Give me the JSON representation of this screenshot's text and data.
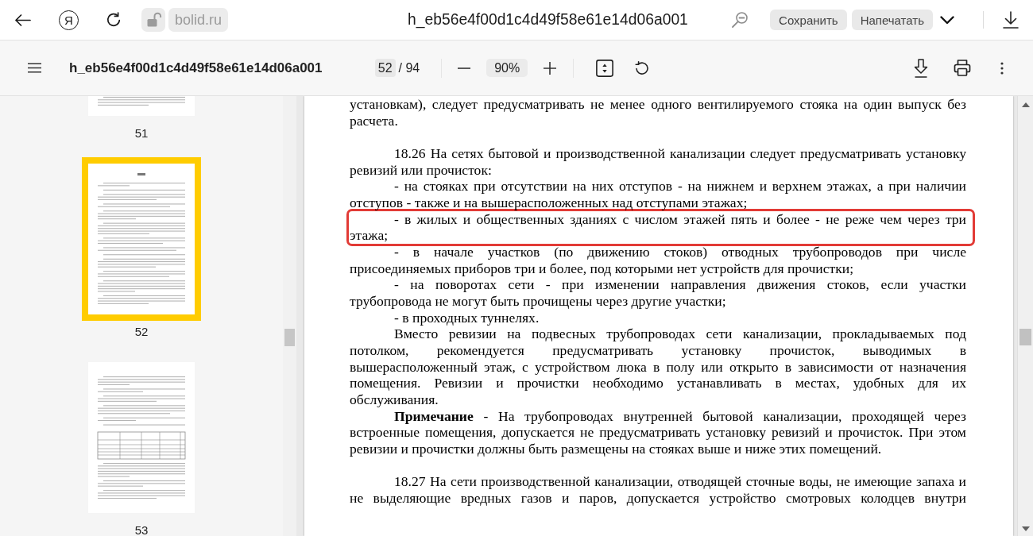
{
  "browser": {
    "logo_letter": "Я",
    "address": "bolid.ru",
    "title": "h_eb56e4f00d1c4d49f58e61e14d06a001",
    "buttons": [
      "Сохранить",
      "Напечатать"
    ]
  },
  "viewer": {
    "file_name": "h_eb56e4f00d1c4d49f58e61e14d06a001",
    "page_current": "52",
    "page_total": "/ 94",
    "zoom": "90%"
  },
  "thumbnails": [
    {
      "label": "51",
      "kind": "text",
      "selected": false
    },
    {
      "label": "52",
      "kind": "text",
      "selected": true
    },
    {
      "label": "53",
      "kind": "table",
      "selected": false
    }
  ],
  "document": {
    "sections": [
      {
        "continued_from_previous_page": true,
        "continues_on_next_page": false,
        "paragraphs": [
          {
            "text": "установкам), следует предусматривать не менее одного вентилируемого стояка на один выпуск без\nрасчета.",
            "highlighted": false
          }
        ]
      },
      {
        "continued_from_previous_page": false,
        "continues_on_next_page": false,
        "paragraphs": [
          {
            "text": "18.26 На сетях бытовой и производственной канализации следует предусматривать установку\nревизий или прочисток:",
            "highlighted": false
          },
          {
            "text": "- на стояках при отсутствии на них отступов - на нижнем и верхнем этажах, а при наличии\nотступов - также и на вышерасположенных над отступами этажах;",
            "highlighted": false
          },
          {
            "text": "- в жилых и общественных зданиях с числом этажей пять и более - не реже чем через три\nэтажа;",
            "highlighted": true
          },
          {
            "text": "- в начале участков (по движению стоков) отводных трубопроводов при числе\nприсоединяемых приборов три и более, под которыми нет устройств для прочистки;",
            "highlighted": false
          },
          {
            "text": "- на поворотах сети - при изменении направления движения стоков, если участки\nтрубопровода не могут быть прочищены через другие участки;",
            "highlighted": false
          },
          {
            "text": "- в проходных туннелях.",
            "highlighted": false
          },
          {
            "text": "Вместо ревизии на подвесных трубопроводах сети канализации, прокладываемых под\nпотолком, рекомендуется предусматривать установку прочисток, выводимых в\nвышерасположенный этаж, с устройством люка в полу или открыто в зависимости от назначения\nпомещения. Ревизии и прочистки необходимо устанавливать в местах, удобных для их\nобслуживания.",
            "highlighted": false
          },
          {
            "text": "**Примечание** - На трубопроводах внутренней бытовой канализации, проходящей через\nвстроенные помещения, допускается не предусматривать установку ревизий и прочисток. При этом\nревизии и прочистки должны быть размещены на стояках выше и ниже этих помещений.",
            "highlighted": false
          }
        ]
      },
      {
        "continued_from_previous_page": false,
        "continues_on_next_page": true,
        "paragraphs": [
          {
            "text": "18.27 На сети производственной канализации, отводящей сточные воды, не имеющие запаха и\nне выделяющие вредных газов и паров, допускается устройство смотровых колодцев внутри",
            "highlighted": false
          }
        ]
      }
    ]
  }
}
